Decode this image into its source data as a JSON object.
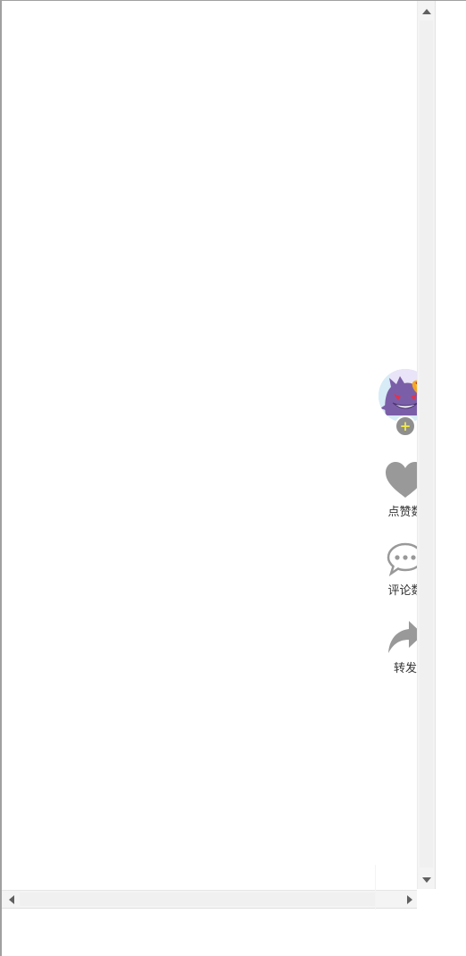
{
  "actions": {
    "like_label": "点赞数",
    "comment_label": "评论数",
    "share_label": "转发"
  },
  "follow_symbol": "+",
  "icons": {
    "avatar": "gengar-avatar",
    "follow": "plus-icon",
    "like": "heart-icon",
    "comment": "speech-bubble-icon",
    "share": "share-arrow-icon"
  },
  "colors": {
    "icon_gray": "#999999",
    "follow_plus": "#f2e94a",
    "avatar_purple": "#7b5ea8",
    "avatar_hat": "#f5a623"
  }
}
